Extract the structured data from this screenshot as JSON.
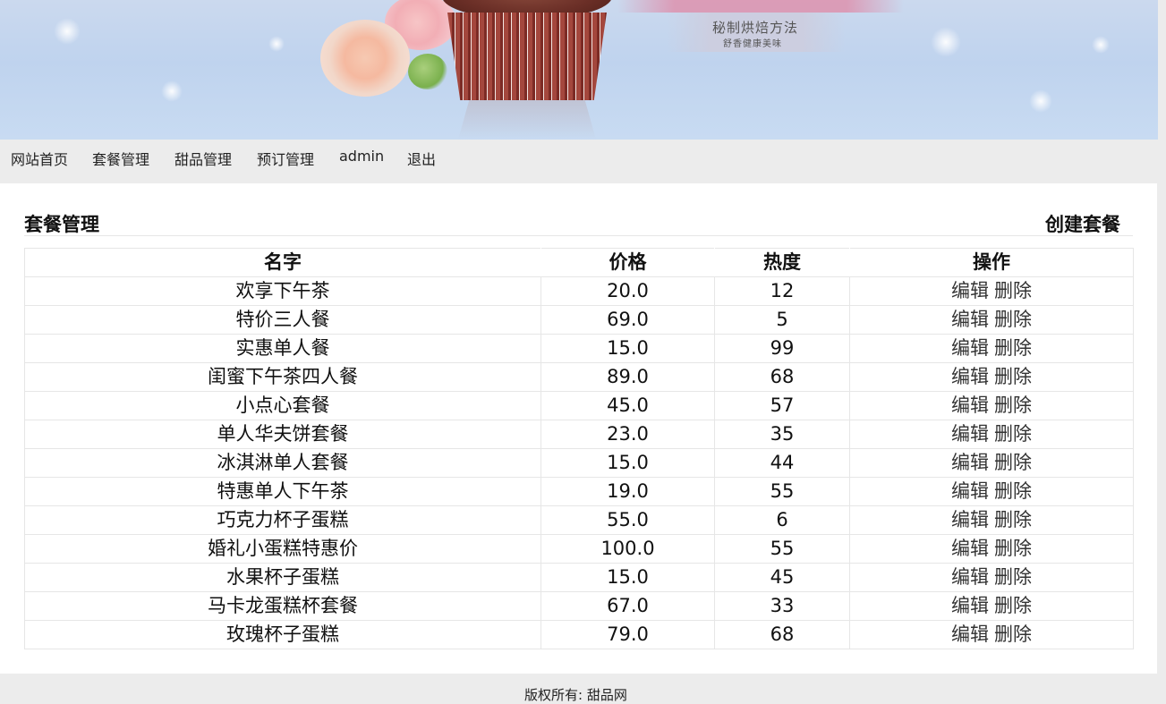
{
  "banner": {
    "line1": "秘制烘焙方法",
    "line2": "舒香健康美味"
  },
  "nav": {
    "items": [
      {
        "label": "网站首页",
        "name": "nav-home"
      },
      {
        "label": "套餐管理",
        "name": "nav-package-manage"
      },
      {
        "label": "甜品管理",
        "name": "nav-dessert-manage"
      },
      {
        "label": "预订管理",
        "name": "nav-reservation-manage"
      },
      {
        "label": "admin",
        "name": "nav-user-admin"
      },
      {
        "label": "退出",
        "name": "nav-logout"
      }
    ]
  },
  "page": {
    "title": "套餐管理",
    "create_label": "创建套餐"
  },
  "table": {
    "headers": [
      "名字",
      "价格",
      "热度",
      "操作"
    ],
    "edit_label": "编辑",
    "delete_label": "删除",
    "rows": [
      {
        "name": "欢享下午茶",
        "price": "20.0",
        "heat": "12"
      },
      {
        "name": "特价三人餐",
        "price": "69.0",
        "heat": "5"
      },
      {
        "name": "实惠单人餐",
        "price": "15.0",
        "heat": "99"
      },
      {
        "name": "闺蜜下午茶四人餐",
        "price": "89.0",
        "heat": "68"
      },
      {
        "name": "小点心套餐",
        "price": "45.0",
        "heat": "57"
      },
      {
        "name": "单人华夫饼套餐",
        "price": "23.0",
        "heat": "35"
      },
      {
        "name": "冰淇淋单人套餐",
        "price": "15.0",
        "heat": "44"
      },
      {
        "name": "特惠单人下午茶",
        "price": "19.0",
        "heat": "55"
      },
      {
        "name": "巧克力杯子蛋糕",
        "price": "55.0",
        "heat": "6"
      },
      {
        "name": "婚礼小蛋糕特惠价",
        "price": "100.0",
        "heat": "55"
      },
      {
        "name": "水果杯子蛋糕",
        "price": "15.0",
        "heat": "45"
      },
      {
        "name": "马卡龙蛋糕杯套餐",
        "price": "67.0",
        "heat": "33"
      },
      {
        "name": "玫瑰杯子蛋糕",
        "price": "79.0",
        "heat": "68"
      }
    ]
  },
  "footer": {
    "text": "版权所有: 甜品网"
  }
}
